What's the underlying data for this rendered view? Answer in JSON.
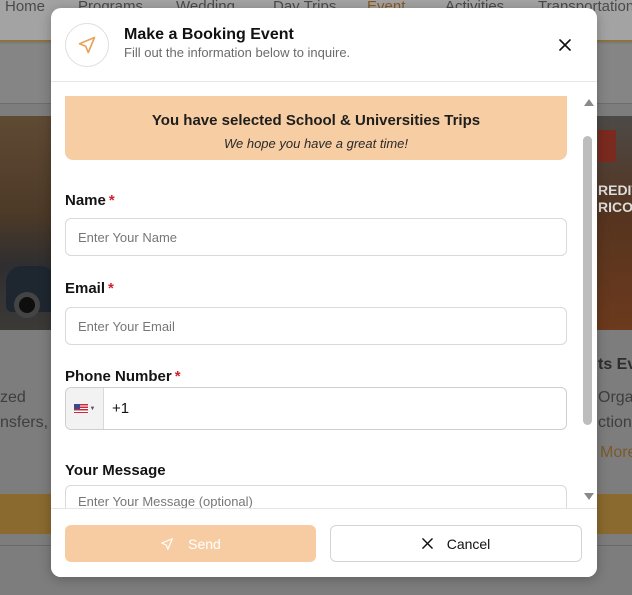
{
  "background": {
    "nav_items": [
      "Home",
      "Programs",
      "Wedding",
      "Day Trips",
      "Event",
      "Activities",
      "Transportation"
    ],
    "active_nav": "Event",
    "left_snippets": [
      "zed",
      "nsfers,"
    ],
    "right_heading": "ts Ev",
    "right_snippets": [
      "Orga",
      "ction"
    ],
    "right_link": "More",
    "photo_sign": "REDIT\nRICO"
  },
  "modal": {
    "title": "Make a Booking Event",
    "subtitle": "Fill out the information below to inquire.",
    "banner": {
      "title": "You have selected School & Universities Trips",
      "subtitle": "We hope you have a great time!"
    },
    "fields": {
      "name": {
        "label": "Name",
        "required_mark": "*",
        "placeholder": "Enter Your Name"
      },
      "email": {
        "label": "Email",
        "required_mark": "*",
        "placeholder": "Enter Your Email"
      },
      "phone": {
        "label": "Phone Number",
        "required_mark": "*",
        "value": "+1",
        "country": "US"
      },
      "message": {
        "label": "Your Message",
        "placeholder": "Enter Your Message (optional)"
      }
    },
    "buttons": {
      "send": "Send",
      "cancel": "Cancel"
    }
  },
  "colors": {
    "accent": "#f7cda3",
    "icon_accent": "#e8a25a",
    "required": "#d0202a"
  },
  "icons": {
    "header": "paper-plane-icon",
    "close": "close-icon",
    "send": "paper-plane-icon",
    "cancel": "close-icon",
    "flag": "us-flag-icon"
  }
}
